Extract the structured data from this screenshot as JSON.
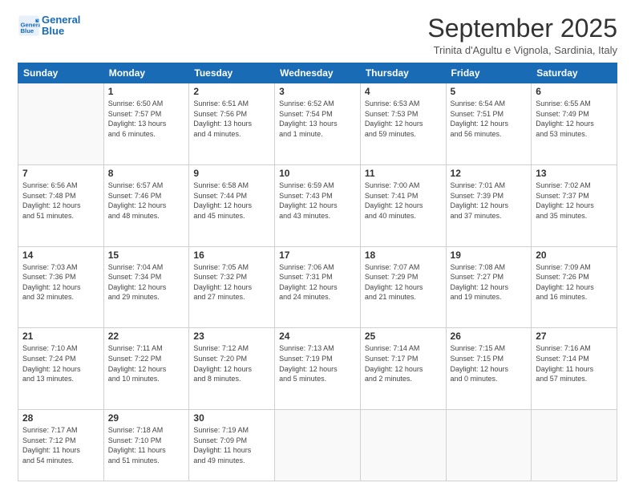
{
  "logo": {
    "line1": "General",
    "line2": "Blue"
  },
  "header": {
    "month": "September 2025",
    "location": "Trinita d'Agultu e Vignola, Sardinia, Italy"
  },
  "weekdays": [
    "Sunday",
    "Monday",
    "Tuesday",
    "Wednesday",
    "Thursday",
    "Friday",
    "Saturday"
  ],
  "weeks": [
    [
      {
        "day": "",
        "info": ""
      },
      {
        "day": "1",
        "info": "Sunrise: 6:50 AM\nSunset: 7:57 PM\nDaylight: 13 hours\nand 6 minutes."
      },
      {
        "day": "2",
        "info": "Sunrise: 6:51 AM\nSunset: 7:56 PM\nDaylight: 13 hours\nand 4 minutes."
      },
      {
        "day": "3",
        "info": "Sunrise: 6:52 AM\nSunset: 7:54 PM\nDaylight: 13 hours\nand 1 minute."
      },
      {
        "day": "4",
        "info": "Sunrise: 6:53 AM\nSunset: 7:53 PM\nDaylight: 12 hours\nand 59 minutes."
      },
      {
        "day": "5",
        "info": "Sunrise: 6:54 AM\nSunset: 7:51 PM\nDaylight: 12 hours\nand 56 minutes."
      },
      {
        "day": "6",
        "info": "Sunrise: 6:55 AM\nSunset: 7:49 PM\nDaylight: 12 hours\nand 53 minutes."
      }
    ],
    [
      {
        "day": "7",
        "info": "Sunrise: 6:56 AM\nSunset: 7:48 PM\nDaylight: 12 hours\nand 51 minutes."
      },
      {
        "day": "8",
        "info": "Sunrise: 6:57 AM\nSunset: 7:46 PM\nDaylight: 12 hours\nand 48 minutes."
      },
      {
        "day": "9",
        "info": "Sunrise: 6:58 AM\nSunset: 7:44 PM\nDaylight: 12 hours\nand 45 minutes."
      },
      {
        "day": "10",
        "info": "Sunrise: 6:59 AM\nSunset: 7:43 PM\nDaylight: 12 hours\nand 43 minutes."
      },
      {
        "day": "11",
        "info": "Sunrise: 7:00 AM\nSunset: 7:41 PM\nDaylight: 12 hours\nand 40 minutes."
      },
      {
        "day": "12",
        "info": "Sunrise: 7:01 AM\nSunset: 7:39 PM\nDaylight: 12 hours\nand 37 minutes."
      },
      {
        "day": "13",
        "info": "Sunrise: 7:02 AM\nSunset: 7:37 PM\nDaylight: 12 hours\nand 35 minutes."
      }
    ],
    [
      {
        "day": "14",
        "info": "Sunrise: 7:03 AM\nSunset: 7:36 PM\nDaylight: 12 hours\nand 32 minutes."
      },
      {
        "day": "15",
        "info": "Sunrise: 7:04 AM\nSunset: 7:34 PM\nDaylight: 12 hours\nand 29 minutes."
      },
      {
        "day": "16",
        "info": "Sunrise: 7:05 AM\nSunset: 7:32 PM\nDaylight: 12 hours\nand 27 minutes."
      },
      {
        "day": "17",
        "info": "Sunrise: 7:06 AM\nSunset: 7:31 PM\nDaylight: 12 hours\nand 24 minutes."
      },
      {
        "day": "18",
        "info": "Sunrise: 7:07 AM\nSunset: 7:29 PM\nDaylight: 12 hours\nand 21 minutes."
      },
      {
        "day": "19",
        "info": "Sunrise: 7:08 AM\nSunset: 7:27 PM\nDaylight: 12 hours\nand 19 minutes."
      },
      {
        "day": "20",
        "info": "Sunrise: 7:09 AM\nSunset: 7:26 PM\nDaylight: 12 hours\nand 16 minutes."
      }
    ],
    [
      {
        "day": "21",
        "info": "Sunrise: 7:10 AM\nSunset: 7:24 PM\nDaylight: 12 hours\nand 13 minutes."
      },
      {
        "day": "22",
        "info": "Sunrise: 7:11 AM\nSunset: 7:22 PM\nDaylight: 12 hours\nand 10 minutes."
      },
      {
        "day": "23",
        "info": "Sunrise: 7:12 AM\nSunset: 7:20 PM\nDaylight: 12 hours\nand 8 minutes."
      },
      {
        "day": "24",
        "info": "Sunrise: 7:13 AM\nSunset: 7:19 PM\nDaylight: 12 hours\nand 5 minutes."
      },
      {
        "day": "25",
        "info": "Sunrise: 7:14 AM\nSunset: 7:17 PM\nDaylight: 12 hours\nand 2 minutes."
      },
      {
        "day": "26",
        "info": "Sunrise: 7:15 AM\nSunset: 7:15 PM\nDaylight: 12 hours\nand 0 minutes."
      },
      {
        "day": "27",
        "info": "Sunrise: 7:16 AM\nSunset: 7:14 PM\nDaylight: 11 hours\nand 57 minutes."
      }
    ],
    [
      {
        "day": "28",
        "info": "Sunrise: 7:17 AM\nSunset: 7:12 PM\nDaylight: 11 hours\nand 54 minutes."
      },
      {
        "day": "29",
        "info": "Sunrise: 7:18 AM\nSunset: 7:10 PM\nDaylight: 11 hours\nand 51 minutes."
      },
      {
        "day": "30",
        "info": "Sunrise: 7:19 AM\nSunset: 7:09 PM\nDaylight: 11 hours\nand 49 minutes."
      },
      {
        "day": "",
        "info": ""
      },
      {
        "day": "",
        "info": ""
      },
      {
        "day": "",
        "info": ""
      },
      {
        "day": "",
        "info": ""
      }
    ]
  ]
}
